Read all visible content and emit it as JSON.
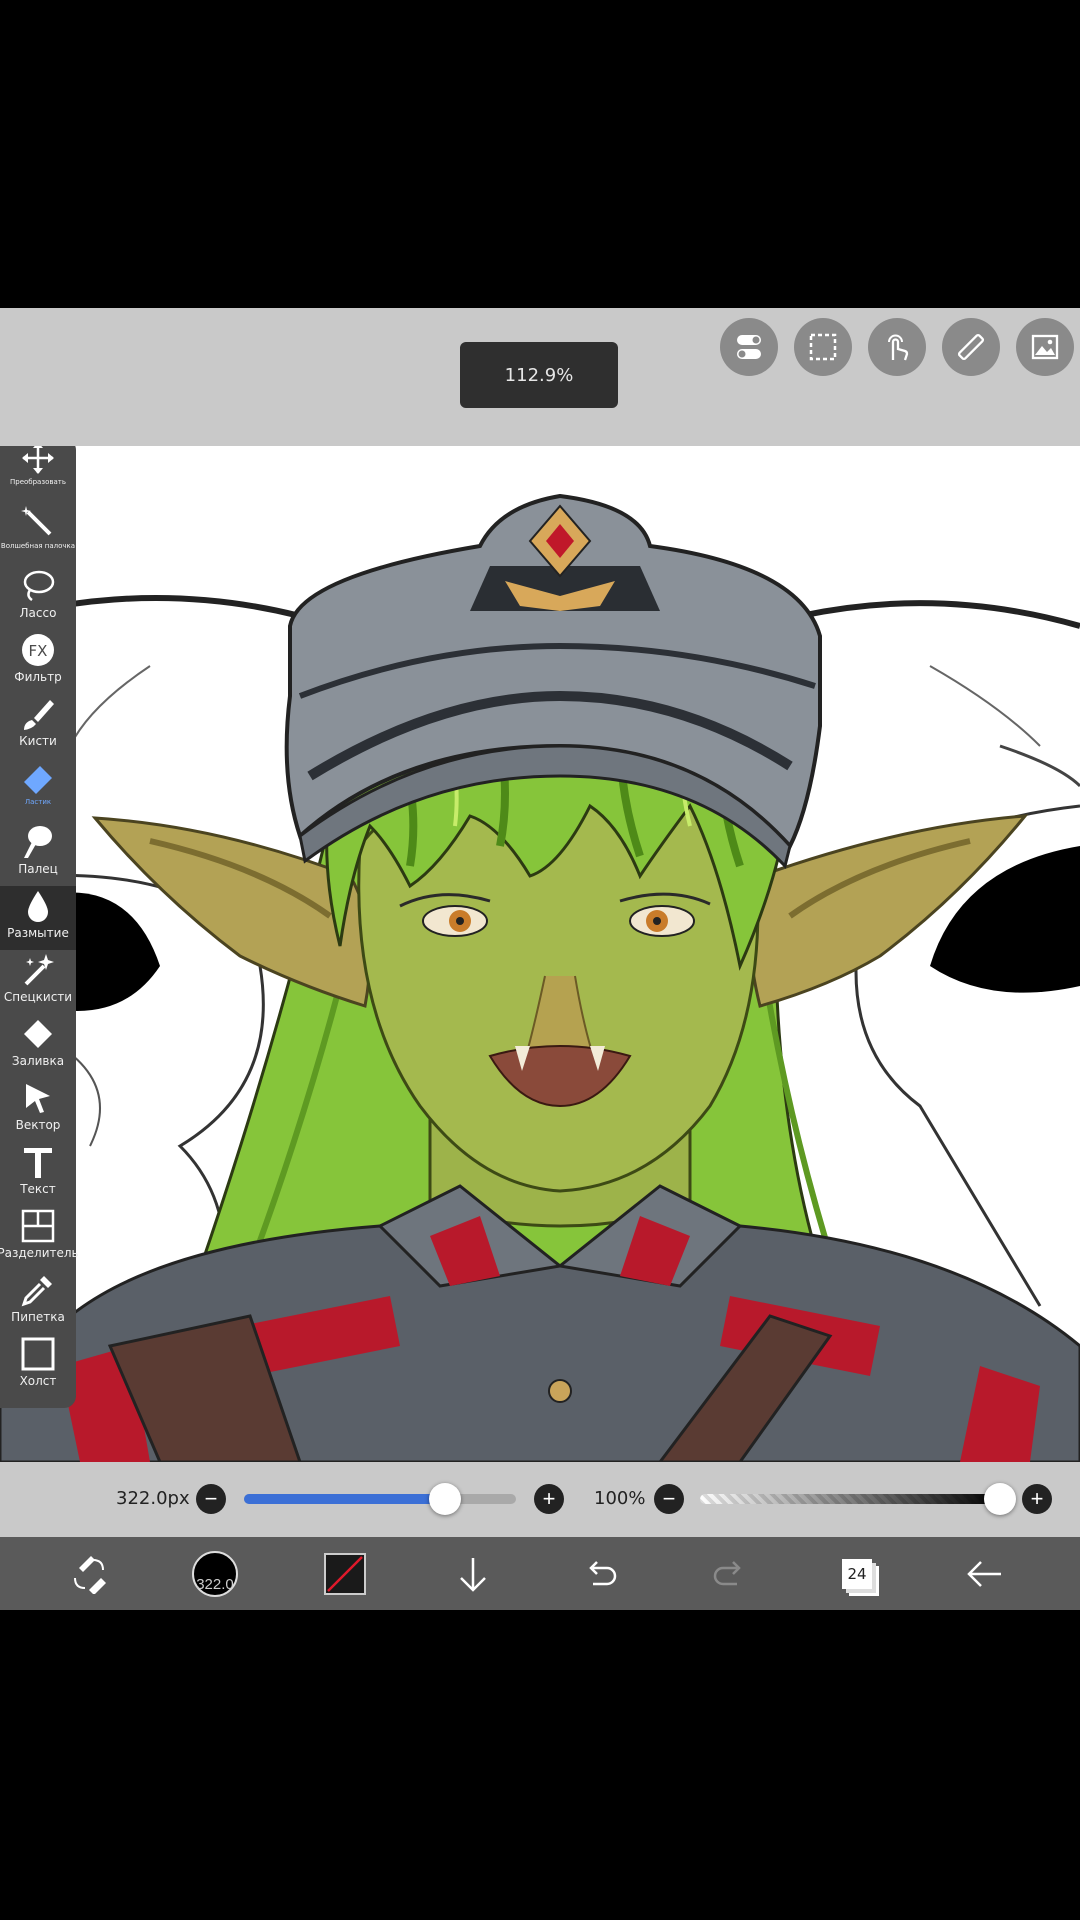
{
  "top": {
    "zoom": "112.9%",
    "icons": [
      "toggle-icon",
      "selection-icon",
      "gesture-icon",
      "ruler-icon",
      "image-icon"
    ]
  },
  "tools": [
    {
      "label": "Преобразовать",
      "icon": "move-icon"
    },
    {
      "label": "Волшебная палочка",
      "icon": "magic-wand-icon"
    },
    {
      "label": "Лассо",
      "icon": "lasso-icon"
    },
    {
      "label": "Фильтр",
      "icon": "fx-icon"
    },
    {
      "label": "Кисти",
      "icon": "brush-icon"
    },
    {
      "label": "Ластик",
      "icon": "eraser-icon"
    },
    {
      "label": "Палец",
      "icon": "smudge-icon"
    },
    {
      "label": "Размытие",
      "icon": "blur-icon"
    },
    {
      "label": "Спецкисти",
      "icon": "special-brush-icon"
    },
    {
      "label": "Заливка",
      "icon": "fill-icon"
    },
    {
      "label": "Вектор",
      "icon": "vector-icon"
    },
    {
      "label": "Текст",
      "icon": "text-icon"
    },
    {
      "label": "Разделитель",
      "icon": "divider-icon"
    },
    {
      "label": "Пипетка",
      "icon": "eyedropper-icon"
    },
    {
      "label": "Холст",
      "icon": "canvas-icon"
    }
  ],
  "active_tool": "Ластик",
  "brush": {
    "size_label": "322.0px",
    "size_fraction": 0.74,
    "opacity_label": "100%",
    "opacity_fraction": 1.0,
    "circle_label": "322.0"
  },
  "bottom": {
    "layer_count": "24",
    "icons": [
      "brush-eraser-toggle-icon",
      "brush-size-icon",
      "color-icon",
      "download-icon",
      "undo-icon",
      "redo-icon",
      "layers-icon",
      "back-icon"
    ]
  },
  "colors": {
    "accent": "#3b6fd6",
    "app_bg": "#c9c9c9",
    "toolbar_bg": "#4a4a4a",
    "bottom_bar": "#5a5a5a",
    "skin": "#a4b94e",
    "hair": "#86c53a",
    "cap": "#8a9199",
    "uniform_red": "#b8192b"
  }
}
